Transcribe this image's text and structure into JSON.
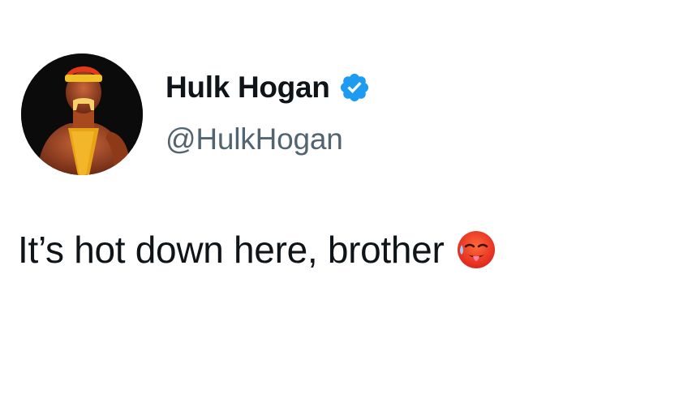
{
  "tweet": {
    "author": {
      "display_name": "Hulk Hogan",
      "handle": "@HulkHogan",
      "verified": true,
      "avatar_icon": "avatar-photo",
      "verified_icon": "verified-badge-icon"
    },
    "text": "It’s hot down here, brother",
    "emoji": "hot-face-emoji",
    "colors": {
      "name": "#0f1419",
      "handle": "#536471",
      "verified": "#1d9bf0",
      "background": "#ffffff"
    }
  }
}
